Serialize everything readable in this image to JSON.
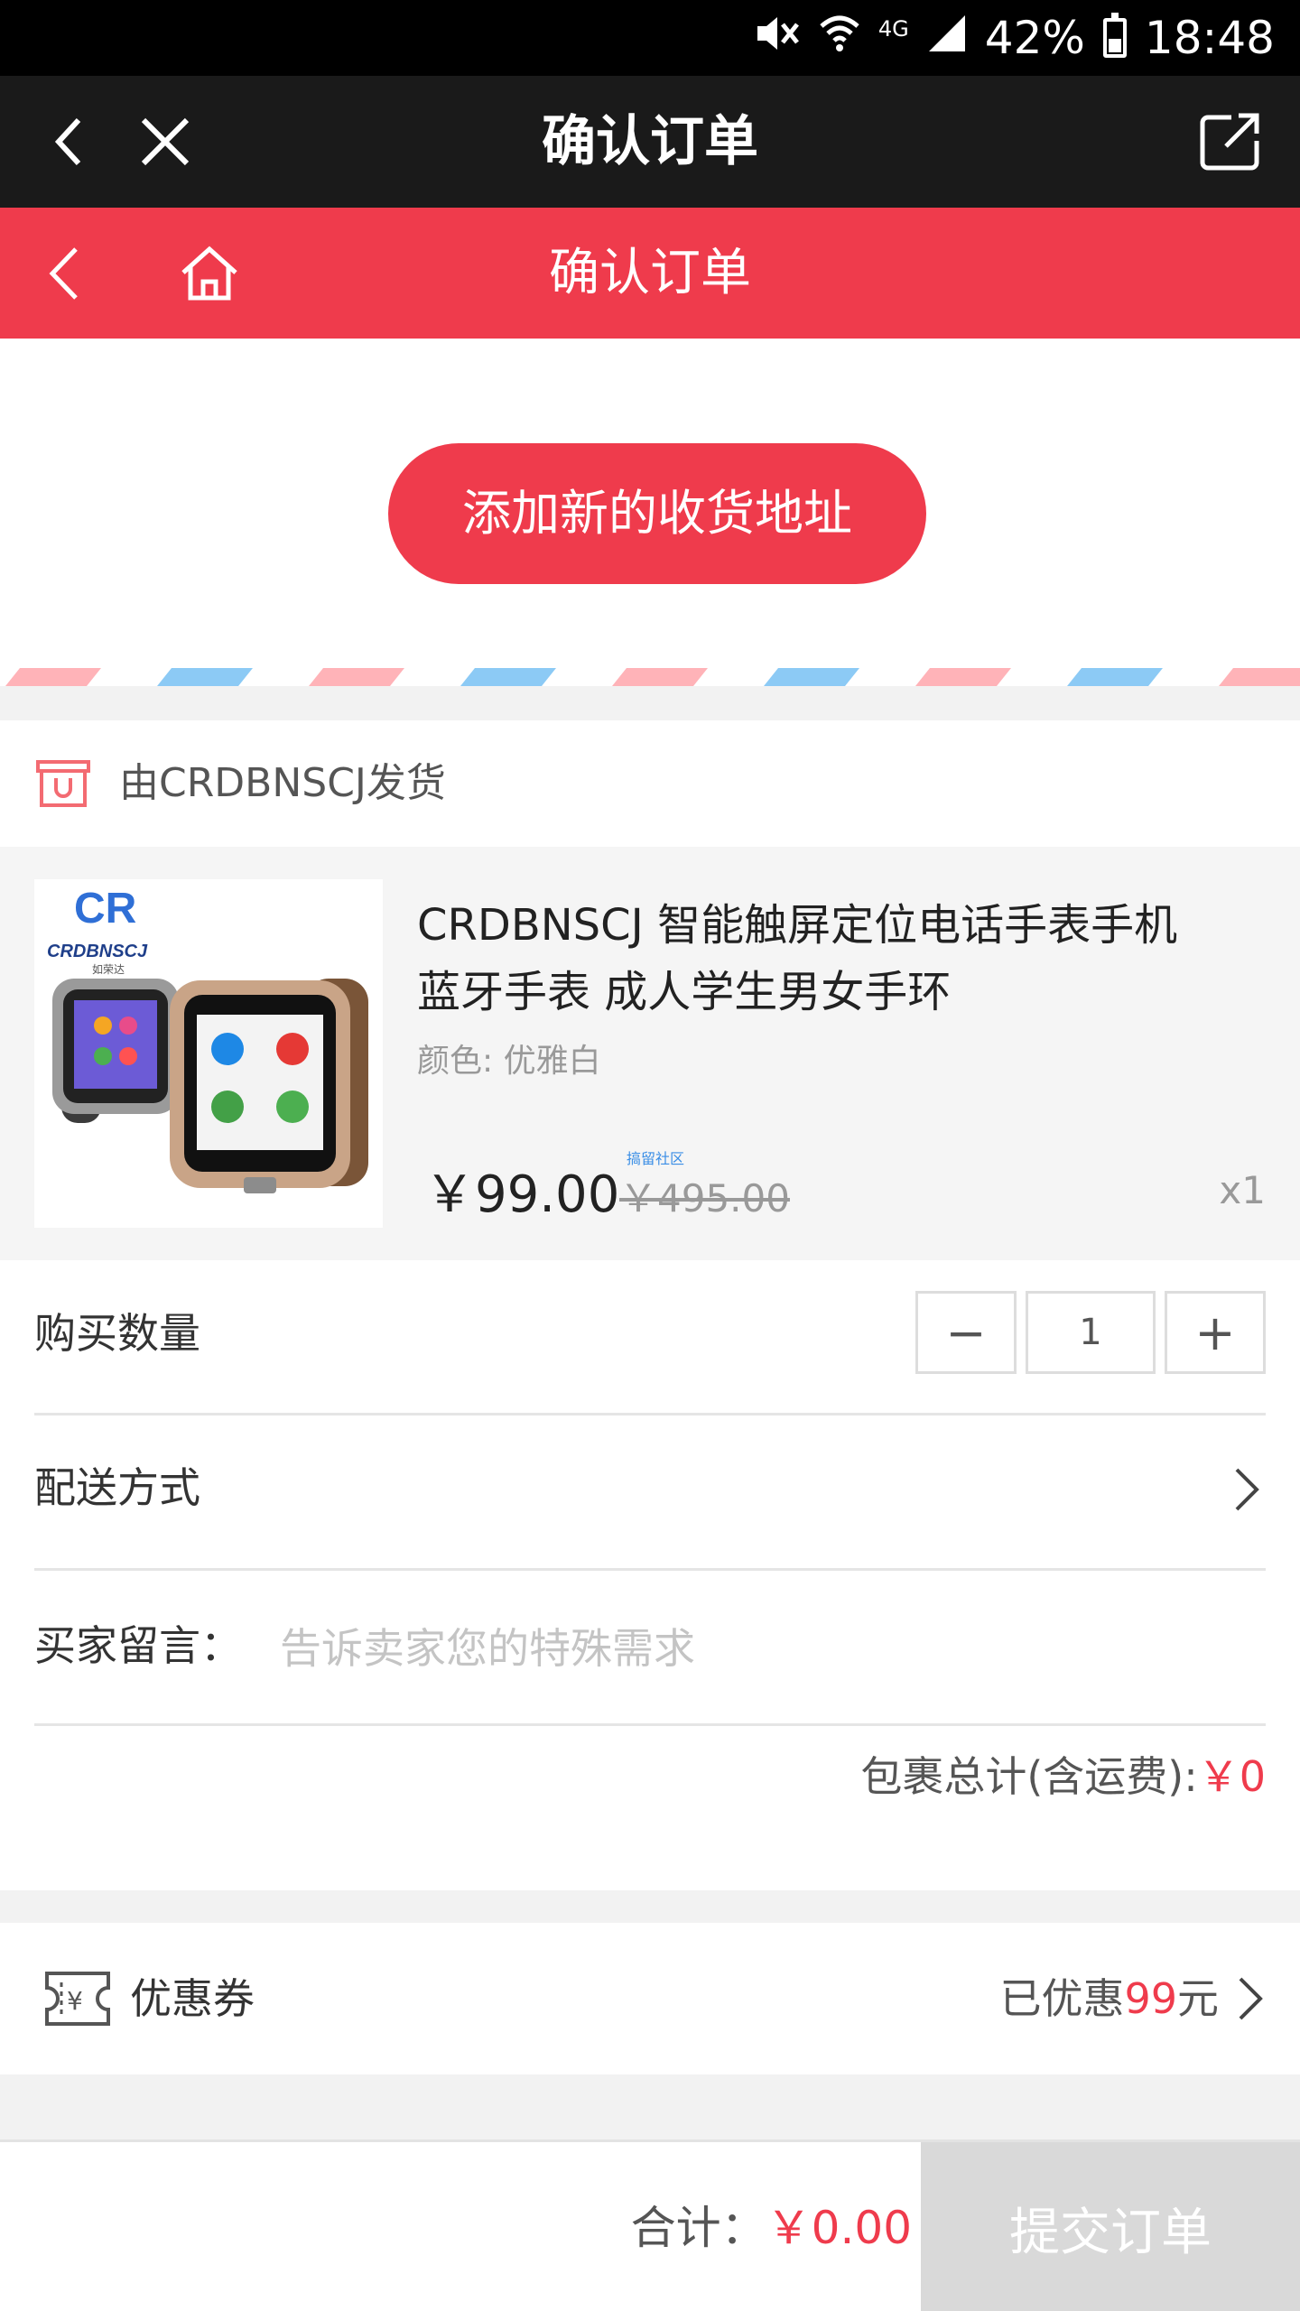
{
  "status_bar": {
    "network": "4G",
    "battery": "42%",
    "battery_level": 0.42,
    "time": "18:48",
    "icons": [
      "mute-icon",
      "wifi-icon",
      "signal-icon",
      "battery-icon"
    ]
  },
  "browser_bar": {
    "title": "确认订单",
    "icons": [
      "back-icon",
      "close-icon",
      "share-icon"
    ]
  },
  "app_header": {
    "title": "确认订单",
    "icons": [
      "back-icon",
      "home-icon"
    ]
  },
  "address": {
    "add_button": "添加新的收货地址"
  },
  "shop": {
    "shipper": "由CRDBNSCJ发货",
    "product": {
      "title_line1": "CRDBNSCJ 智能触屏定位电话手表手机",
      "title_line2": "蓝牙手表 成人学生男女手环",
      "color": "颜色: 优雅白",
      "price": "￥99.00",
      "original_price": "￥495.00",
      "watermark": "搞留社区",
      "quantity": "x1",
      "thumb_brand": "CRDBNSCJ",
      "thumb_sub": "如荣达"
    },
    "quantity_row": {
      "label": "购买数量",
      "minus": "−",
      "value": "1",
      "plus": "+"
    },
    "delivery_row": {
      "label": "配送方式"
    },
    "message_row": {
      "label": "买家留言：",
      "placeholder": "告诉卖家您的特殊需求"
    },
    "package_total": {
      "label": "包裹总计(含运费):",
      "value": "￥0"
    }
  },
  "coupon": {
    "label": "优惠券",
    "prefix": "已优惠",
    "amount": "99",
    "suffix": "元"
  },
  "bottom_bar": {
    "total_label": "合计：",
    "total_value": "￥0.00",
    "submit": "提交订单"
  },
  "colors": {
    "brand_red": "#ef3b4c",
    "dark_bar": "#1a1a1a",
    "disabled": "#d9d9d9"
  }
}
